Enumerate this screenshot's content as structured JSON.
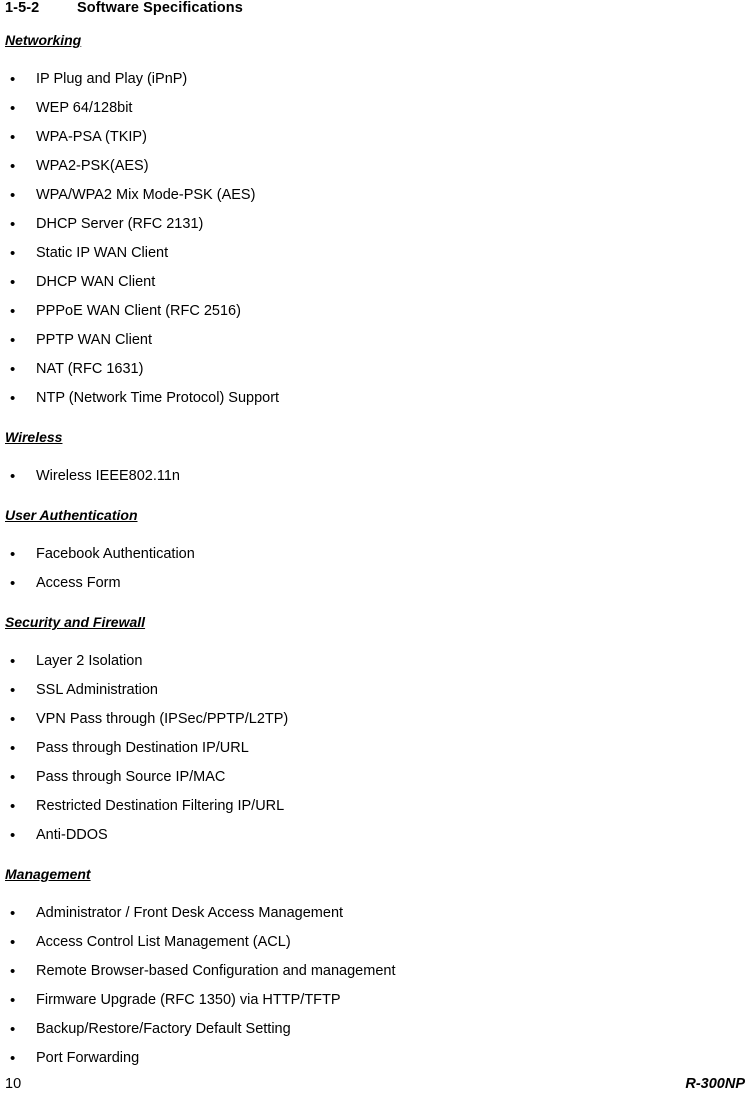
{
  "title": {
    "number": "1-5-2",
    "text": "Software Specifications"
  },
  "sections": [
    {
      "heading": "Networking",
      "items": [
        "IP Plug and Play (iPnP)",
        "WEP 64/128bit",
        "WPA-PSA (TKIP)",
        "WPA2-PSK(AES)",
        "WPA/WPA2 Mix Mode-PSK (AES)",
        "DHCP Server (RFC 2131)",
        "Static IP WAN Client",
        "DHCP WAN Client",
        "PPPoE WAN Client (RFC 2516)",
        "PPTP WAN Client",
        "NAT (RFC 1631)",
        "NTP (Network Time Protocol) Support"
      ]
    },
    {
      "heading": "Wireless",
      "items": [
        "Wireless IEEE802.11n"
      ]
    },
    {
      "heading": "User Authentication",
      "items": [
        "Facebook Authentication",
        "Access Form"
      ]
    },
    {
      "heading": "Security and Firewall",
      "items": [
        "Layer 2 Isolation",
        "SSL Administration",
        "VPN Pass through (IPSec/PPTP/L2TP)",
        "Pass through Destination IP/URL",
        "Pass through Source IP/MAC",
        "Restricted Destination Filtering IP/URL",
        "Anti-DDOS"
      ]
    },
    {
      "heading": "Management",
      "items": [
        "Administrator / Front Desk Access Management",
        "Access Control List Management (ACL)",
        "Remote Browser-based Configuration and management",
        "Firmware Upgrade (RFC 1350) via HTTP/TFTP",
        "Backup/Restore/Factory Default Setting",
        "Port Forwarding"
      ]
    }
  ],
  "footer": {
    "page_number": "10",
    "model": "R-300NP"
  },
  "bullet_glyph": "•"
}
